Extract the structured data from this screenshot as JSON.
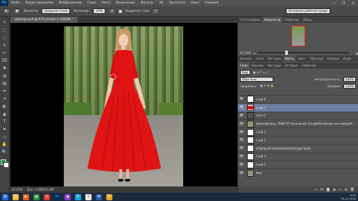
{
  "app": {
    "logo": "Ps"
  },
  "menu": [
    "Файл",
    "Редактирование",
    "Изображение",
    "Слои",
    "Текст",
    "Выделение",
    "Фильтр",
    "3D",
    "Просмотр",
    "Окно",
    "Справка"
  ],
  "window_controls": [
    "—",
    "❐",
    "✕"
  ],
  "options": {
    "mode_label": "Диаметр:",
    "mode_value": "Средняя точка",
    "exposure_label": "Экспонир.:",
    "exposure_value": "20%",
    "protect_label": "Защитить тона",
    "workspace": "Основная рабочая среда"
  },
  "document": {
    "tab": "одежда.psd @ 67% (Слой 3, RGB/8) *"
  },
  "status": {
    "zoom": "67,03%",
    "doc": "Док: 2,88M/11,8M"
  },
  "tools": [
    "↖",
    "⬚",
    "◌",
    "✎",
    "✂",
    "⌧",
    "✚",
    "◍",
    "▤",
    "✒",
    "≈",
    "◐",
    "▲",
    "T",
    "➤",
    "▭",
    "✋",
    "🔍"
  ],
  "panel": {
    "top_tabs": [
      "Гистограмма",
      "Навигатор",
      "Свойства",
      "Абзац"
    ],
    "zoom": "67,03%",
    "mid_tabs": [
      "Каналы",
      "Слои",
      "Контуры",
      "Кисть",
      "Цвет",
      "Образцы",
      "Наборы",
      "Инфо"
    ],
    "mid_active": "Кисть",
    "layer_tabs": [
      "Слои",
      "Каналы",
      "Контуры",
      "История",
      "Свойства"
    ],
    "kind_label": "Вид",
    "blend": "Обычные",
    "opacity_label": "Непрозрачность:",
    "opacity": "100%",
    "lock_label": "Закрепить:",
    "fill_label": "Заливка:",
    "fill": "100%",
    "layers": [
      {
        "name": "Слой 6",
        "selected": false
      },
      {
        "name": "Слой 3",
        "selected": true
      },
      {
        "name": "ruhr+2",
        "selected": false
      },
      {
        "name": "depositphotos_1968757-stock-photo-thoughtful-blonde-on-a-footpath",
        "selected": false
      },
      {
        "name": "Слой 5",
        "selected": false
      },
      {
        "name": "Слой 2",
        "selected": false
      },
      {
        "name": "HTB4lqlsR1kKXXXXXXXXXXXXqXFXXXX",
        "selected": false
      },
      {
        "name": "Слой 4",
        "selected": false
      },
      {
        "name": "Слой 1",
        "selected": false
      },
      {
        "name": "Фон",
        "selected": false
      }
    ]
  },
  "taskbar": {
    "time": "9:25",
    "date": "25.11.2016"
  }
}
